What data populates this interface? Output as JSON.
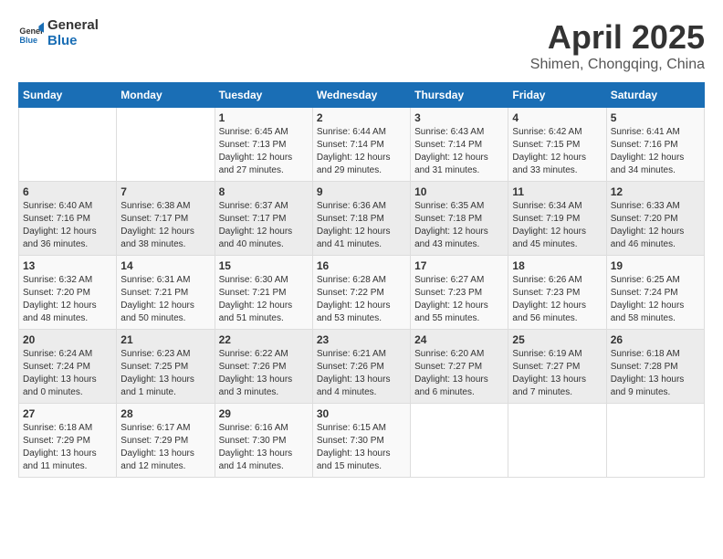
{
  "logo": {
    "line1": "General",
    "line2": "Blue"
  },
  "title": "April 2025",
  "subtitle": "Shimen, Chongqing, China",
  "header": {
    "days": [
      "Sunday",
      "Monday",
      "Tuesday",
      "Wednesday",
      "Thursday",
      "Friday",
      "Saturday"
    ]
  },
  "weeks": [
    [
      {
        "num": "",
        "details": ""
      },
      {
        "num": "",
        "details": ""
      },
      {
        "num": "1",
        "details": "Sunrise: 6:45 AM\nSunset: 7:13 PM\nDaylight: 12 hours\nand 27 minutes."
      },
      {
        "num": "2",
        "details": "Sunrise: 6:44 AM\nSunset: 7:14 PM\nDaylight: 12 hours\nand 29 minutes."
      },
      {
        "num": "3",
        "details": "Sunrise: 6:43 AM\nSunset: 7:14 PM\nDaylight: 12 hours\nand 31 minutes."
      },
      {
        "num": "4",
        "details": "Sunrise: 6:42 AM\nSunset: 7:15 PM\nDaylight: 12 hours\nand 33 minutes."
      },
      {
        "num": "5",
        "details": "Sunrise: 6:41 AM\nSunset: 7:16 PM\nDaylight: 12 hours\nand 34 minutes."
      }
    ],
    [
      {
        "num": "6",
        "details": "Sunrise: 6:40 AM\nSunset: 7:16 PM\nDaylight: 12 hours\nand 36 minutes."
      },
      {
        "num": "7",
        "details": "Sunrise: 6:38 AM\nSunset: 7:17 PM\nDaylight: 12 hours\nand 38 minutes."
      },
      {
        "num": "8",
        "details": "Sunrise: 6:37 AM\nSunset: 7:17 PM\nDaylight: 12 hours\nand 40 minutes."
      },
      {
        "num": "9",
        "details": "Sunrise: 6:36 AM\nSunset: 7:18 PM\nDaylight: 12 hours\nand 41 minutes."
      },
      {
        "num": "10",
        "details": "Sunrise: 6:35 AM\nSunset: 7:18 PM\nDaylight: 12 hours\nand 43 minutes."
      },
      {
        "num": "11",
        "details": "Sunrise: 6:34 AM\nSunset: 7:19 PM\nDaylight: 12 hours\nand 45 minutes."
      },
      {
        "num": "12",
        "details": "Sunrise: 6:33 AM\nSunset: 7:20 PM\nDaylight: 12 hours\nand 46 minutes."
      }
    ],
    [
      {
        "num": "13",
        "details": "Sunrise: 6:32 AM\nSunset: 7:20 PM\nDaylight: 12 hours\nand 48 minutes."
      },
      {
        "num": "14",
        "details": "Sunrise: 6:31 AM\nSunset: 7:21 PM\nDaylight: 12 hours\nand 50 minutes."
      },
      {
        "num": "15",
        "details": "Sunrise: 6:30 AM\nSunset: 7:21 PM\nDaylight: 12 hours\nand 51 minutes."
      },
      {
        "num": "16",
        "details": "Sunrise: 6:28 AM\nSunset: 7:22 PM\nDaylight: 12 hours\nand 53 minutes."
      },
      {
        "num": "17",
        "details": "Sunrise: 6:27 AM\nSunset: 7:23 PM\nDaylight: 12 hours\nand 55 minutes."
      },
      {
        "num": "18",
        "details": "Sunrise: 6:26 AM\nSunset: 7:23 PM\nDaylight: 12 hours\nand 56 minutes."
      },
      {
        "num": "19",
        "details": "Sunrise: 6:25 AM\nSunset: 7:24 PM\nDaylight: 12 hours\nand 58 minutes."
      }
    ],
    [
      {
        "num": "20",
        "details": "Sunrise: 6:24 AM\nSunset: 7:24 PM\nDaylight: 13 hours\nand 0 minutes."
      },
      {
        "num": "21",
        "details": "Sunrise: 6:23 AM\nSunset: 7:25 PM\nDaylight: 13 hours\nand 1 minute."
      },
      {
        "num": "22",
        "details": "Sunrise: 6:22 AM\nSunset: 7:26 PM\nDaylight: 13 hours\nand 3 minutes."
      },
      {
        "num": "23",
        "details": "Sunrise: 6:21 AM\nSunset: 7:26 PM\nDaylight: 13 hours\nand 4 minutes."
      },
      {
        "num": "24",
        "details": "Sunrise: 6:20 AM\nSunset: 7:27 PM\nDaylight: 13 hours\nand 6 minutes."
      },
      {
        "num": "25",
        "details": "Sunrise: 6:19 AM\nSunset: 7:27 PM\nDaylight: 13 hours\nand 7 minutes."
      },
      {
        "num": "26",
        "details": "Sunrise: 6:18 AM\nSunset: 7:28 PM\nDaylight: 13 hours\nand 9 minutes."
      }
    ],
    [
      {
        "num": "27",
        "details": "Sunrise: 6:18 AM\nSunset: 7:29 PM\nDaylight: 13 hours\nand 11 minutes."
      },
      {
        "num": "28",
        "details": "Sunrise: 6:17 AM\nSunset: 7:29 PM\nDaylight: 13 hours\nand 12 minutes."
      },
      {
        "num": "29",
        "details": "Sunrise: 6:16 AM\nSunset: 7:30 PM\nDaylight: 13 hours\nand 14 minutes."
      },
      {
        "num": "30",
        "details": "Sunrise: 6:15 AM\nSunset: 7:30 PM\nDaylight: 13 hours\nand 15 minutes."
      },
      {
        "num": "",
        "details": ""
      },
      {
        "num": "",
        "details": ""
      },
      {
        "num": "",
        "details": ""
      }
    ]
  ]
}
